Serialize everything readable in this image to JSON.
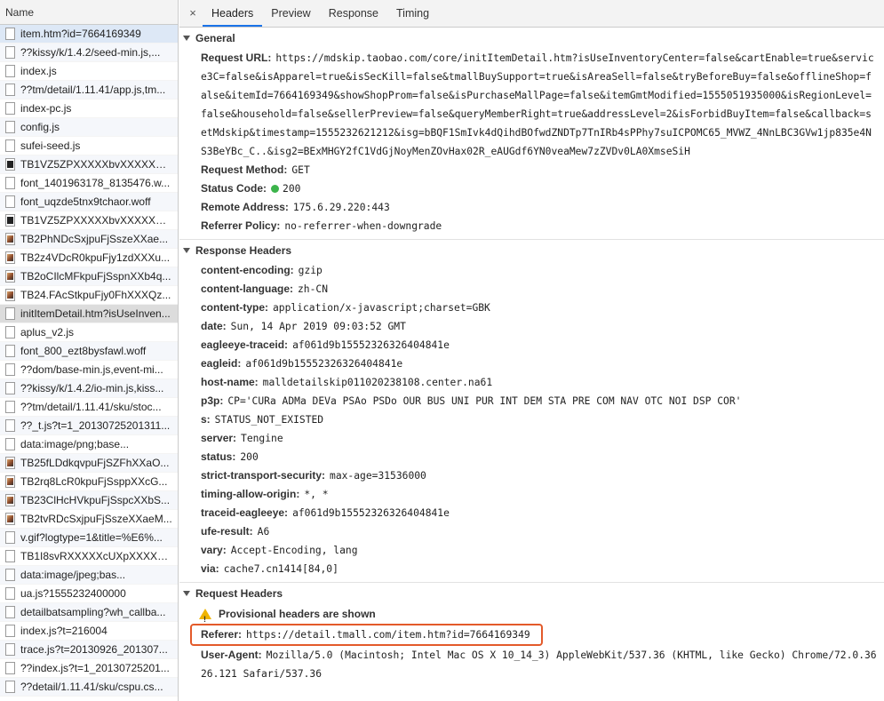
{
  "left": {
    "header": "Name",
    "rows": [
      {
        "label": "item.htm?id=7664169349",
        "icon": "doc",
        "hl": "blue"
      },
      {
        "label": "??kissy/k/1.4.2/seed-min.js,...",
        "icon": "doc"
      },
      {
        "label": "index.js",
        "icon": "doc"
      },
      {
        "label": "??tm/detail/1.11.41/app.js,tm...",
        "icon": "doc"
      },
      {
        "label": "index-pc.js",
        "icon": "doc"
      },
      {
        "label": "config.js",
        "icon": "doc"
      },
      {
        "label": "sufei-seed.js",
        "icon": "doc"
      },
      {
        "label": "TB1VZ5ZPXXXXXbvXXXXXXX...",
        "icon": "dark"
      },
      {
        "label": "font_1401963178_8135476.w...",
        "icon": "doc"
      },
      {
        "label": "font_uqzde5tnx9tchaor.woff",
        "icon": "doc"
      },
      {
        "label": "TB1VZ5ZPXXXXXbvXXXXXXX...",
        "icon": "dark"
      },
      {
        "label": "TB2PhNDcSxjpuFjSszeXXae...",
        "icon": "img"
      },
      {
        "label": "TB2z4VDcR0kpuFjy1zdXXXu...",
        "icon": "img"
      },
      {
        "label": "TB2oCIlcMFkpuFjSspnXXb4q...",
        "icon": "img"
      },
      {
        "label": "TB24.FAcStkpuFjy0FhXXXQz...",
        "icon": "img"
      },
      {
        "label": "initItemDetail.htm?isUseInven...",
        "icon": "doc",
        "hl": "gray"
      },
      {
        "label": "aplus_v2.js",
        "icon": "doc"
      },
      {
        "label": "font_800_ezt8bysfawl.woff",
        "icon": "doc"
      },
      {
        "label": "??dom/base-min.js,event-mi...",
        "icon": "doc"
      },
      {
        "label": "??kissy/k/1.4.2/io-min.js,kiss...",
        "icon": "doc"
      },
      {
        "label": "??tm/detail/1.11.41/sku/stoc...",
        "icon": "doc"
      },
      {
        "label": "??_t.js?t=1_20130725201311...",
        "icon": "doc"
      },
      {
        "label": "data:image/png;base...",
        "icon": "doc"
      },
      {
        "label": "TB25fLDdkqvpuFjSZFhXXaO...",
        "icon": "img"
      },
      {
        "label": "TB2rq8LcR0kpuFjSsppXXcG...",
        "icon": "img"
      },
      {
        "label": "TB23ClHcHVkpuFjSspcXXbS...",
        "icon": "img"
      },
      {
        "label": "TB2tvRDcSxjpuFjSszeXXaeM...",
        "icon": "img"
      },
      {
        "label": "v.gif?logtype=1&title=%E6%...",
        "icon": "doc"
      },
      {
        "label": "TB1I8svRXXXXXcUXpXXXXX...",
        "icon": "doc"
      },
      {
        "label": "data:image/jpeg;bas...",
        "icon": "doc"
      },
      {
        "label": "ua.js?1555232400000",
        "icon": "doc"
      },
      {
        "label": "detailbatsampling?wh_callba...",
        "icon": "doc"
      },
      {
        "label": "index.js?t=216004",
        "icon": "doc"
      },
      {
        "label": "trace.js?t=20130926_201307...",
        "icon": "doc"
      },
      {
        "label": "??index.js?t=1_20130725201...",
        "icon": "doc"
      },
      {
        "label": "??detail/1.11.41/sku/cspu.cs...",
        "icon": "doc"
      }
    ]
  },
  "tabs": {
    "close": "×",
    "items": [
      "Headers",
      "Preview",
      "Response",
      "Timing"
    ],
    "active": "Headers"
  },
  "general": {
    "title": "General",
    "request_url_label": "Request URL:",
    "request_url": "https://mdskip.taobao.com/core/initItemDetail.htm?isUseInventoryCenter=false&cartEnable=true&service3C=false&isApparel=true&isSecKill=false&tmallBuySupport=true&isAreaSell=false&tryBeforeBuy=false&offlineShop=false&itemId=7664169349&showShopProm=false&isPurchaseMallPage=false&itemGmtModified=1555051935000&isRegionLevel=false&household=false&sellerPreview=false&queryMemberRight=true&addressLevel=2&isForbidBuyItem=false&callback=setMdskip&timestamp=1555232621212&isg=bBQF1SmIvk4dQihdBOfwdZNDTp7TnIRb4sPPhy7suICPOMC65_MVWZ_4NnLBC3GVw1jp835e4NS3BeYBc_C..&isg2=BExMHGY2fC1VdGjNoyMenZOvHax02R_eAUGdf6YN0veaMew7zZVDv0LA0XmseSiH",
    "method_label": "Request Method:",
    "method": "GET",
    "status_label": "Status Code:",
    "status": "200",
    "remote_label": "Remote Address:",
    "remote": "175.6.29.220:443",
    "policy_label": "Referrer Policy:",
    "policy": "no-referrer-when-downgrade"
  },
  "response": {
    "title": "Response Headers",
    "headers": [
      {
        "k": "content-encoding:",
        "v": "gzip"
      },
      {
        "k": "content-language:",
        "v": "zh-CN"
      },
      {
        "k": "content-type:",
        "v": "application/x-javascript;charset=GBK"
      },
      {
        "k": "date:",
        "v": "Sun, 14 Apr 2019 09:03:52 GMT"
      },
      {
        "k": "eagleeye-traceid:",
        "v": "af061d9b15552326326404841e"
      },
      {
        "k": "eagleid:",
        "v": "af061d9b15552326326404841e"
      },
      {
        "k": "host-name:",
        "v": "malldetailskip011020238108.center.na61"
      },
      {
        "k": "p3p:",
        "v": "CP='CURa ADMa DEVa PSAo PSDo OUR BUS UNI PUR INT DEM STA PRE COM NAV OTC NOI DSP COR'"
      },
      {
        "k": "s:",
        "v": "STATUS_NOT_EXISTED"
      },
      {
        "k": "server:",
        "v": "Tengine"
      },
      {
        "k": "status:",
        "v": "200"
      },
      {
        "k": "strict-transport-security:",
        "v": "max-age=31536000"
      },
      {
        "k": "timing-allow-origin:",
        "v": "*, *"
      },
      {
        "k": "traceid-eagleeye:",
        "v": "af061d9b15552326326404841e"
      },
      {
        "k": "ufe-result:",
        "v": "A6"
      },
      {
        "k": "vary:",
        "v": "Accept-Encoding, lang"
      },
      {
        "k": "via:",
        "v": "cache7.cn1414[84,0]"
      }
    ]
  },
  "request": {
    "title": "Request Headers",
    "provisional": "Provisional headers are shown",
    "referer_label": "Referer:",
    "referer": "https://detail.tmall.com/item.htm?id=7664169349",
    "ua_label": "User-Agent:",
    "ua": "Mozilla/5.0 (Macintosh; Intel Mac OS X 10_14_3) AppleWebKit/537.36 (KHTML, like Gecko) Chrome/72.0.3626.121 Safari/537.36"
  },
  "colors": {
    "accent": "#1a73e8",
    "status_ok": "#3cb44b",
    "highlight_box": "#e35a2a"
  }
}
